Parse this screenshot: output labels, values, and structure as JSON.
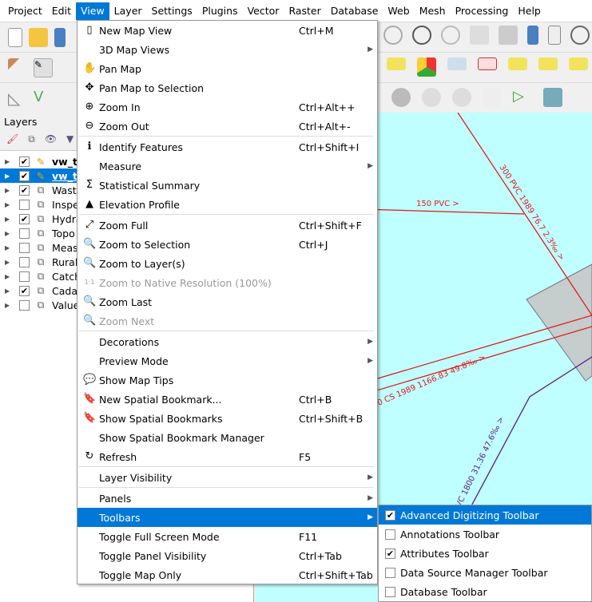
{
  "menubar": [
    "Project",
    "Edit",
    "View",
    "Layer",
    "Settings",
    "Plugins",
    "Vector",
    "Raster",
    "Database",
    "Web",
    "Mesh",
    "Processing",
    "Help"
  ],
  "active_menu": "View",
  "layers": {
    "title": "Layers",
    "items": [
      {
        "name": "vw_t",
        "checked": true,
        "bold": true,
        "selected": false
      },
      {
        "name": "vw_t",
        "checked": true,
        "bold": true,
        "selected": true
      },
      {
        "name": "Wast",
        "checked": true
      },
      {
        "name": "Inspe",
        "checked": false
      },
      {
        "name": "Hydra",
        "checked": true
      },
      {
        "name": "Topo",
        "checked": false
      },
      {
        "name": "Meas",
        "checked": false
      },
      {
        "name": "Rural",
        "checked": false
      },
      {
        "name": "Catch",
        "checked": false
      },
      {
        "name": "Cada",
        "checked": true
      },
      {
        "name": "Value",
        "checked": false
      }
    ]
  },
  "view_menu": [
    {
      "label": "New Map View",
      "shortcut": "Ctrl+M",
      "icon": "new-map-view-icon",
      "glyph": "▯"
    },
    {
      "label": "3D Map Views",
      "submenu": true
    },
    {
      "label": "Pan Map",
      "icon": "pan-hand-icon",
      "glyph": "✋"
    },
    {
      "label": "Pan Map to Selection",
      "icon": "pan-selection-icon",
      "glyph": "✥"
    },
    {
      "label": "Zoom In",
      "shortcut": "Ctrl+Alt++",
      "icon": "zoom-in-icon",
      "glyph": "⊕"
    },
    {
      "label": "Zoom Out",
      "shortcut": "Ctrl+Alt+-",
      "icon": "zoom-out-icon",
      "glyph": "⊖"
    },
    {
      "sep": true
    },
    {
      "label": "Identify Features",
      "shortcut": "Ctrl+Shift+I",
      "icon": "identify-icon",
      "glyph": "ℹ"
    },
    {
      "label": "Measure",
      "submenu": true
    },
    {
      "label": "Statistical Summary",
      "icon": "sigma-icon",
      "glyph": "Σ"
    },
    {
      "label": "Elevation Profile",
      "icon": "elevation-profile-icon",
      "glyph": "▲"
    },
    {
      "sep": true
    },
    {
      "label": "Zoom Full",
      "shortcut": "Ctrl+Shift+F",
      "icon": "zoom-full-icon",
      "glyph": "⤢"
    },
    {
      "label": "Zoom to Selection",
      "shortcut": "Ctrl+J",
      "icon": "zoom-selection-icon",
      "glyph": "🔍"
    },
    {
      "label": "Zoom to Layer(s)",
      "icon": "zoom-layer-icon",
      "glyph": "🔍"
    },
    {
      "label": "Zoom to Native Resolution (100%)",
      "icon": "zoom-native-icon",
      "glyph": "1:1",
      "disabled": true
    },
    {
      "label": "Zoom Last",
      "icon": "zoom-last-icon",
      "glyph": "🔍"
    },
    {
      "label": "Zoom Next",
      "icon": "zoom-next-icon",
      "glyph": "🔍",
      "disabled": true
    },
    {
      "sep": true
    },
    {
      "label": "Decorations",
      "submenu": true
    },
    {
      "label": "Preview Mode",
      "submenu": true
    },
    {
      "label": "Show Map Tips",
      "icon": "map-tips-icon",
      "glyph": "💬"
    },
    {
      "label": "New Spatial Bookmark...",
      "shortcut": "Ctrl+B",
      "icon": "new-bookmark-icon",
      "glyph": "🔖"
    },
    {
      "label": "Show Spatial Bookmarks",
      "shortcut": "Ctrl+Shift+B",
      "icon": "bookmarks-icon",
      "glyph": "🔖"
    },
    {
      "label": "Show Spatial Bookmark Manager"
    },
    {
      "label": "Refresh",
      "shortcut": "F5",
      "icon": "refresh-icon",
      "glyph": "↻"
    },
    {
      "sep": true
    },
    {
      "label": "Layer Visibility",
      "submenu": true
    },
    {
      "sep": true
    },
    {
      "label": "Panels",
      "submenu": true
    },
    {
      "label": "Toolbars",
      "submenu": true,
      "highlighted": true
    },
    {
      "label": "Toggle Full Screen Mode",
      "shortcut": "F11"
    },
    {
      "label": "Toggle Panel Visibility",
      "shortcut": "Ctrl+Tab"
    },
    {
      "label": "Toggle Map Only",
      "shortcut": "Ctrl+Shift+Tab"
    }
  ],
  "toolbars_submenu": [
    {
      "label": "Advanced Digitizing Toolbar",
      "checked": true,
      "highlighted": true
    },
    {
      "label": "Annotations Toolbar",
      "checked": false
    },
    {
      "label": "Attributes Toolbar",
      "checked": true
    },
    {
      "label": "Data Source Manager Toolbar",
      "checked": false
    },
    {
      "label": "Database Toolbar",
      "checked": false
    }
  ],
  "map": {
    "background": "#bfffff",
    "labels": {
      "l1": "300 PVC 1989 76.7 2.3‰ >",
      "l2": "150 PVC >",
      "l3": "0 CS 1989 1166.83 49.8‰ >",
      "l4": "VC 1800 31.36 47.6‰ >"
    }
  },
  "colors": {
    "accent": "#0078d7",
    "pipe": "#e31a1c",
    "pipe2": "#5b1a8a"
  }
}
